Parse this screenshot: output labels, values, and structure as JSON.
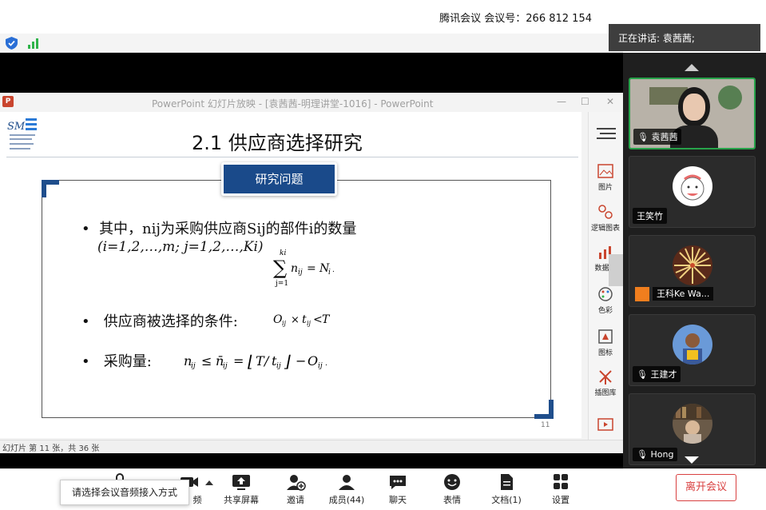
{
  "meeting": {
    "id_label": "腾讯会议 会议号：266 812 154",
    "speaking": "正在讲话: 袁茜茜;"
  },
  "ppt": {
    "window_title": "PowerPoint 幻灯片放映 - [袁茜茜-明理讲堂-1016] - PowerPoint",
    "status": "幻灯片 第 11 张，共 36 张",
    "slide": {
      "heading": "2.1 供应商选择研究",
      "pill": "研究问题",
      "bullet1": "其中，nij为采购供应商Sij的部件i的数量",
      "bullet1b": "(i=1,2,…,m; j=1,2,…,Ki)",
      "bullet2": "供应商被选择的条件:",
      "bullet3": "采购量:",
      "page_number": "11"
    },
    "tools": [
      "图片",
      "逻辑图表",
      "数据图",
      "色彩",
      "图标",
      "插图库"
    ]
  },
  "participants": [
    {
      "name": "袁茜茜"
    },
    {
      "name": "王笑竹"
    },
    {
      "name": "王科Ke Wa..."
    },
    {
      "name": "王建才"
    },
    {
      "name": "Hong"
    }
  ],
  "toolbar": {
    "video_label": "频",
    "share": "共享屏幕",
    "invite": "邀请",
    "members": "成员(44)",
    "chat": "聊天",
    "reaction": "表情",
    "docs": "文档(1)",
    "settings": "设置",
    "leave": "离开会议",
    "audio_tooltip": "请选择会议音频接入方式"
  },
  "colors": {
    "accent_blue": "#1a4a8a",
    "leave_red": "#d94040",
    "active_green": "#27a34a"
  }
}
